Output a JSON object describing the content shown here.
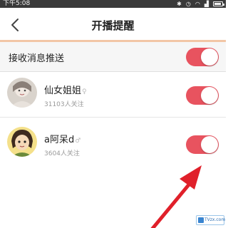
{
  "status_bar": {
    "time": "下午5:08",
    "icons": [
      "bluetooth-icon",
      "alarm-icon",
      "wifi-icon",
      "signal-icon",
      "battery-icon"
    ]
  },
  "header": {
    "title": "开播提醒",
    "back_icon": "chevron-left-icon"
  },
  "master_toggle": {
    "label": "接收消息推送",
    "enabled": true
  },
  "anchors": [
    {
      "name": "仙女姐姐",
      "gender_symbol": "♀",
      "followers": "31103人关注",
      "notify_enabled": true
    },
    {
      "name": "a阿呆d",
      "gender_symbol": "♂",
      "followers": "3604人关注",
      "notify_enabled": true
    }
  ],
  "colors": {
    "accent": "#e8535f",
    "header_underline": "#f2c6a6",
    "annotation_arrow": "#e0202a",
    "status_bar_bg": "#3a3a3a"
  },
  "watermark": {
    "text": "TVzx.com"
  }
}
